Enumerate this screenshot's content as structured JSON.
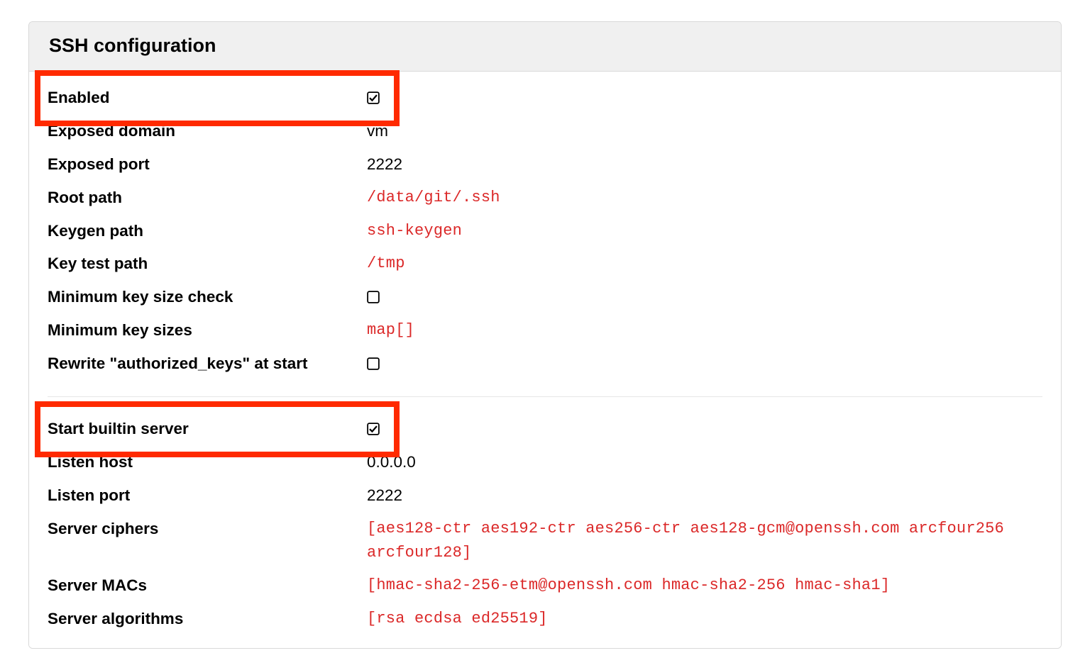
{
  "panel": {
    "title": "SSH configuration"
  },
  "group1": {
    "rows": [
      {
        "label": "Enabled",
        "type": "check",
        "checked": true
      },
      {
        "label": "Exposed domain",
        "type": "plain",
        "value": "vm"
      },
      {
        "label": "Exposed port",
        "type": "plain",
        "value": "2222"
      },
      {
        "label": "Root path",
        "type": "mono",
        "value": "/data/git/.ssh"
      },
      {
        "label": "Keygen path",
        "type": "mono",
        "value": "ssh-keygen"
      },
      {
        "label": "Key test path",
        "type": "mono",
        "value": "/tmp"
      },
      {
        "label": "Minimum key size check",
        "type": "check",
        "checked": false
      },
      {
        "label": "Minimum key sizes",
        "type": "mono",
        "value": "map[]"
      },
      {
        "label": "Rewrite \"authorized_keys\" at start",
        "type": "check",
        "checked": false
      }
    ]
  },
  "group2": {
    "rows": [
      {
        "label": "Start builtin server",
        "type": "check",
        "checked": true
      },
      {
        "label": "Listen host",
        "type": "plain",
        "value": "0.0.0.0"
      },
      {
        "label": "Listen port",
        "type": "plain",
        "value": "2222"
      },
      {
        "label": "Server ciphers",
        "type": "mono",
        "value": "[aes128-ctr aes192-ctr aes256-ctr aes128-gcm@openssh.com arcfour256 arcfour128]"
      },
      {
        "label": "Server MACs",
        "type": "mono",
        "value": "[hmac-sha2-256-etm@openssh.com hmac-sha2-256 hmac-sha1]"
      },
      {
        "label": "Server algorithms",
        "type": "mono",
        "value": "[rsa ecdsa ed25519]"
      }
    ]
  },
  "highlights": [
    {
      "group": 1,
      "row": 0
    },
    {
      "group": 2,
      "row": 0
    }
  ]
}
